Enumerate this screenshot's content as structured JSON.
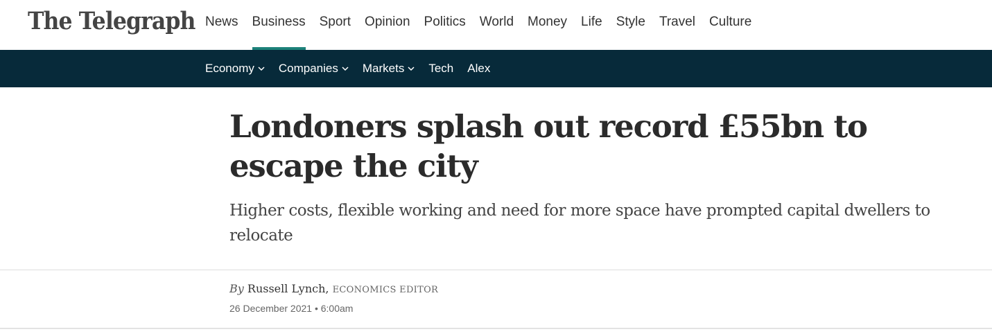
{
  "brand": {
    "logo_text": "The Telegraph"
  },
  "topnav": {
    "items": [
      {
        "label": "News"
      },
      {
        "label": "Business",
        "active": true
      },
      {
        "label": "Sport"
      },
      {
        "label": "Opinion"
      },
      {
        "label": "Politics"
      },
      {
        "label": "World"
      },
      {
        "label": "Money"
      },
      {
        "label": "Life"
      },
      {
        "label": "Style"
      },
      {
        "label": "Travel"
      },
      {
        "label": "Culture"
      }
    ]
  },
  "subnav": {
    "items": [
      {
        "label": "Economy",
        "icon": "chevron-down-icon"
      },
      {
        "label": "Companies",
        "icon": "chevron-down-icon"
      },
      {
        "label": "Markets",
        "icon": "chevron-down-icon"
      },
      {
        "label": "Tech"
      },
      {
        "label": "Alex"
      }
    ]
  },
  "article": {
    "headline": "Londoners splash out record £55bn to escape the city",
    "standfirst": "Higher costs, flexible working and need for more space have prompted capital dwellers to relocate",
    "byline": {
      "prefix": "By",
      "author": "Russell Lynch,",
      "role": "Economics Editor"
    },
    "date": "26 December 2021 • 6:00am"
  },
  "colors": {
    "accent": "#1c8179",
    "subnav_bg": "#072a3a"
  }
}
